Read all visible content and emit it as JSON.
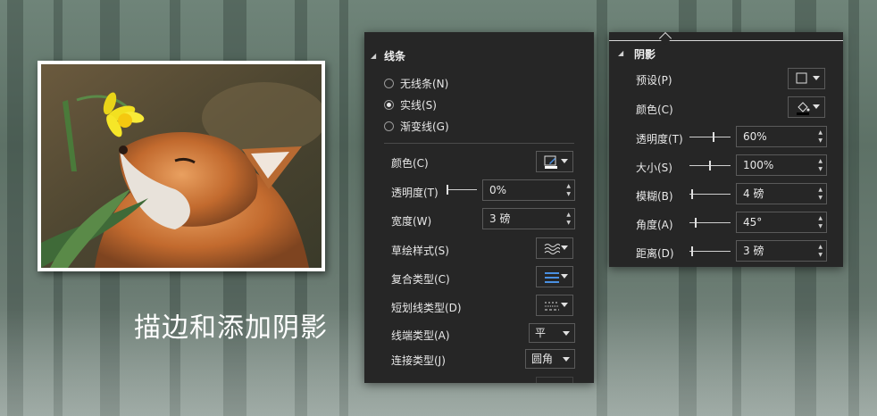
{
  "caption": "描边和添加阴影",
  "line_panel": {
    "section_title": "线条",
    "radios": [
      {
        "label": "无线条(N)",
        "checked": false
      },
      {
        "label": "实线(S)",
        "checked": true
      },
      {
        "label": "渐变线(G)",
        "checked": false
      }
    ],
    "color_label": "颜色(C)",
    "transparency_label": "透明度(T)",
    "transparency_value": "0%",
    "width_label": "宽度(W)",
    "width_value": "3 磅",
    "sketch_label": "草绘样式(S)",
    "compound_label": "复合类型(C)",
    "dash_label": "短划线类型(D)",
    "cap_label": "线端类型(A)",
    "cap_value": "平",
    "join_label": "连接类型(J)",
    "join_value": "圆角",
    "accent_color": "#4a90e2"
  },
  "shadow_panel": {
    "section_title": "阴影",
    "preset_label": "预设(P)",
    "color_label": "颜色(C)",
    "transparency_label": "透明度(T)",
    "transparency_value": "60%",
    "size_label": "大小(S)",
    "size_value": "100%",
    "blur_label": "模糊(B)",
    "blur_value": "4 磅",
    "angle_label": "角度(A)",
    "angle_value": "45°",
    "distance_label": "距离(D)",
    "distance_value": "3 磅"
  }
}
